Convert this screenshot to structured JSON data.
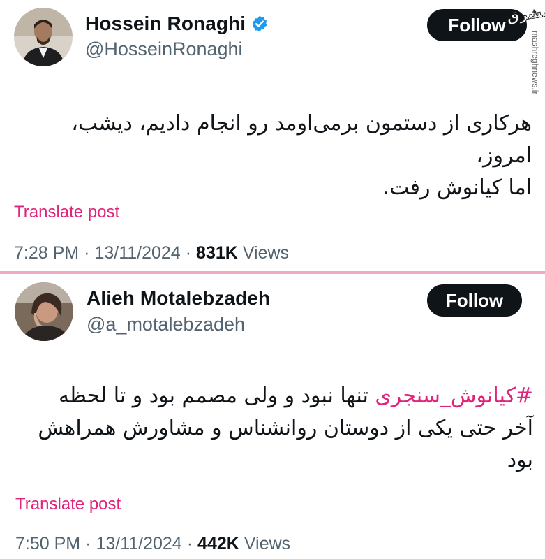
{
  "tweets": [
    {
      "display_name": "Hossein Ronaghi",
      "verified": true,
      "handle": "@HosseinRonaghi",
      "follow_label": "Follow",
      "text_line1": "هرکاری از دستمون برمی‌اومد رو انجام دادیم، دیشب، امروز،",
      "text_line2": "اما کیانوش رفت.",
      "translate_label": "Translate post",
      "time": "7:28 PM",
      "date": "13/11/2024",
      "views_count": "831K",
      "views_label": "Views"
    },
    {
      "display_name": "Alieh Motalebzadeh",
      "verified": false,
      "handle": "@a_motalebzadeh",
      "follow_label": "Follow",
      "hashtag": "#کیانوش_سنجری",
      "text_line1_rest": " تنها نبود و  ولی مصمم بود و تا لحظه",
      "text_line2": "آخر حتی یکی از دوستان روانشناس و مشاورش همراهش",
      "text_line3": "بود",
      "translate_label": "Translate post",
      "time": "7:50 PM",
      "date": "13/11/2024",
      "views_count": "442K",
      "views_label": "Views"
    }
  ],
  "watermark": {
    "logo": "مشرق",
    "url": "mashreghnews.ir"
  },
  "colors": {
    "accent_pink": "#e0247a",
    "verified_blue": "#1d9bf0",
    "divider": "#f0a9c4"
  },
  "icons": [
    "verified-badge-icon"
  ]
}
